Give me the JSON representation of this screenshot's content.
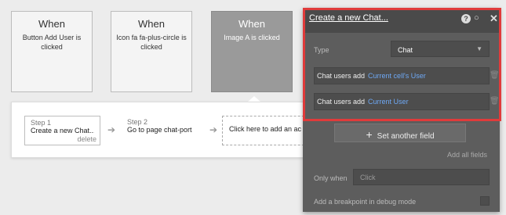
{
  "events": [
    {
      "when": "When",
      "desc": "Button Add User is clicked"
    },
    {
      "when": "When",
      "desc": "Icon fa fa-plus-circle is clicked"
    },
    {
      "when": "When",
      "desc": "Image A is clicked"
    }
  ],
  "steps": [
    {
      "num": "Step 1",
      "label": "Create a new Chat...",
      "delete": "delete"
    },
    {
      "num": "Step 2",
      "label": "Go to page chat-portal"
    }
  ],
  "add_action": "Click here to add an ac",
  "panel": {
    "title": "Create a new Chat...",
    "help_icon": "?",
    "comment_icon": "○",
    "close_icon": "✕",
    "type_label": "Type",
    "type_value": "Chat",
    "fields": [
      {
        "label": "Chat users add",
        "value": "Current cell's User"
      },
      {
        "label": "Chat users add",
        "value": "Current User"
      }
    ],
    "set_another": "Set another field",
    "add_all": "Add all fields",
    "only_when_label": "Only when",
    "only_when_placeholder": "Click",
    "breakpoint_label": "Add a breakpoint in debug mode"
  },
  "colors": {
    "highlight": "#e03b3b",
    "link": "#6ea8f4",
    "panel": "#5d5d5d"
  }
}
